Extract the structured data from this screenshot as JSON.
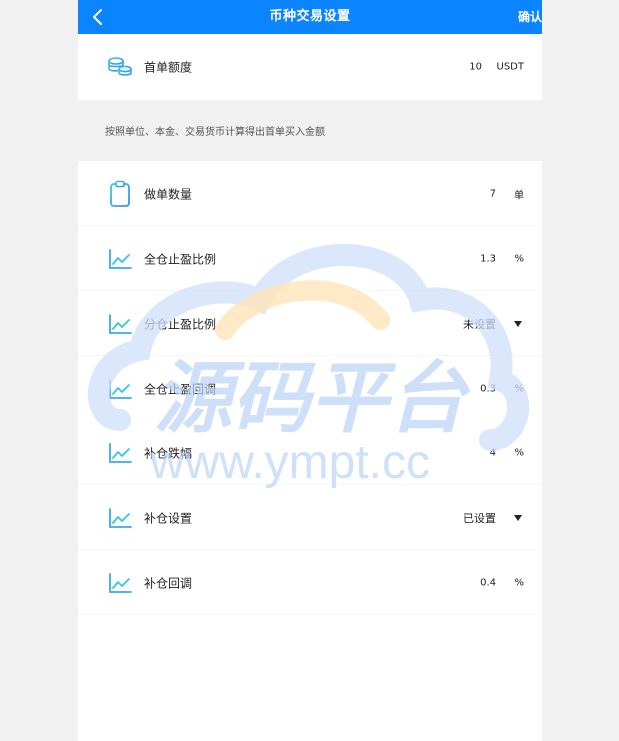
{
  "header": {
    "title": "币种交易设置",
    "confirm_label": "确认"
  },
  "first_order": {
    "label": "首单额度",
    "value": "10",
    "unit": "USDT",
    "icon": "coins-icon"
  },
  "hint": "按照单位、本金、交易货币计算得出首单买入金额",
  "rows": [
    {
      "label": "做单数量",
      "value": "7",
      "unit": "单",
      "icon": "clipboard-icon"
    },
    {
      "label": "全仓止盈比例",
      "value": "1.3",
      "unit": "%",
      "icon": "line-chart-icon"
    },
    {
      "label": "分仓止盈比例",
      "select": "未设置",
      "icon": "line-chart-icon"
    },
    {
      "label": "全仓止盈回调",
      "value": "0.3",
      "unit": "%",
      "icon": "line-chart-icon"
    },
    {
      "label": "补仓跌幅",
      "value": "4",
      "unit": "%",
      "icon": "line-chart-icon"
    },
    {
      "label": "补仓设置",
      "select": "已设置",
      "icon": "line-chart-icon"
    },
    {
      "label": "补仓回调",
      "value": "0.4",
      "unit": "%",
      "icon": "line-chart-icon"
    }
  ],
  "watermark": {
    "cn": "源码平台",
    "url": "www.ympt.cc"
  },
  "colors": {
    "accent": "#0a84ff",
    "icon": "#3aa8f0",
    "background": "#f1f1f1"
  }
}
